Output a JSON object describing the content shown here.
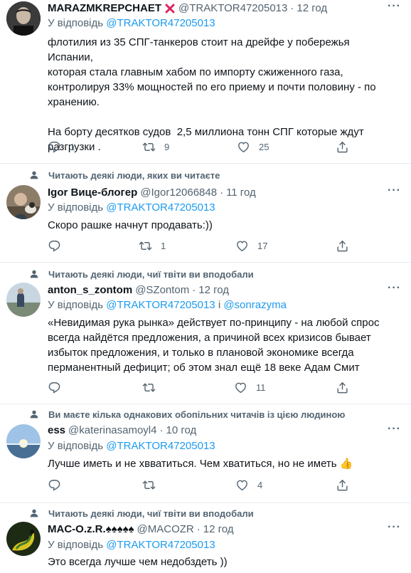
{
  "tweets": [
    {
      "context": "",
      "name": "MARAZMKREPCHAET",
      "badge": "❌",
      "handle": "@TRAKTOR47205013",
      "dot": "·",
      "time": "12 год",
      "reply_prefix": "У відповідь",
      "reply_to": "@TRAKTOR47205013",
      "reply_and": "",
      "reply_to2": "",
      "text": "флотилия из 35 СПГ-танкеров стоит на дрейфе у побережья Испании,\nкоторая стала главным хабом по импорту сжиженного газа,\nконтролируя 33% мощностей по его приему и почти половину - по\nхранению.\n\nНа борту десятков судов  2,5 миллиона тонн СПГ которые ждут\nразгрузки .",
      "replies": "1",
      "retweets": "9",
      "likes": "25"
    },
    {
      "context": "Читають деякі люди, яких ви читаєте",
      "name": "Igor Вице-блогер",
      "badge": "",
      "handle": "@Igor12066848",
      "dot": "·",
      "time": "11 год",
      "reply_prefix": "У відповідь",
      "reply_to": "@TRAKTOR47205013",
      "reply_and": "",
      "reply_to2": "",
      "text": "Скоро рашке начнут продавать:))",
      "replies": "",
      "retweets": "1",
      "likes": "17"
    },
    {
      "context": "Читають деякі люди, чиї твіти ви вподобали",
      "name": "anton_s_zontom",
      "badge": "",
      "handle": "@SZontom",
      "dot": "·",
      "time": "12 год",
      "reply_prefix": "У відповідь",
      "reply_to": "@TRAKTOR47205013",
      "reply_and": "і",
      "reply_to2": "@sonrazyma",
      "text": "«Невидимая рука рынка» действует по-принципу - на любой спрос\nвсегда найдётся предложения, а причиной всех кризисов бывает\nизбыток предложения, и только в плановой экономике всегда\nперманентный дефицит; об этом знал ещё 18 веке Адам Смит",
      "replies": "",
      "retweets": "",
      "likes": "11"
    },
    {
      "context": "Ви маєте кілька однакових обопільних читачів із цією людиною",
      "name": "ess",
      "badge": "",
      "handle": "@katerinasamoyl4",
      "dot": "·",
      "time": "10 год",
      "reply_prefix": "У відповідь",
      "reply_to": "@TRAKTOR47205013",
      "reply_and": "",
      "reply_to2": "",
      "text": "Лучше иметь и не хвватиться. Чем хватиться, но не иметь 👍",
      "replies": "",
      "retweets": "",
      "likes": "4"
    },
    {
      "context": "Читають деякі люди, чиї твіти ви вподобали",
      "name": "MAC-O.z.R.♠♠♠♠♠",
      "badge": "",
      "handle": "@MACOZR",
      "dot": "·",
      "time": "12 год",
      "reply_prefix": "У відповідь",
      "reply_to": "@TRAKTOR47205013",
      "reply_and": "",
      "reply_to2": "",
      "text": "Это всегда лучше чем недобздеть ))",
      "replies": "",
      "retweets": "",
      "likes": ""
    }
  ],
  "more_label": "···",
  "icons": {
    "context": "person-icon",
    "reply": "reply-icon",
    "retweet": "retweet-icon",
    "like": "heart-icon",
    "share": "share-icon",
    "more": "more-icon"
  },
  "colors": {
    "link": "#1d9bf0",
    "secondary": "#536471",
    "separator": "#e6ecf0"
  }
}
